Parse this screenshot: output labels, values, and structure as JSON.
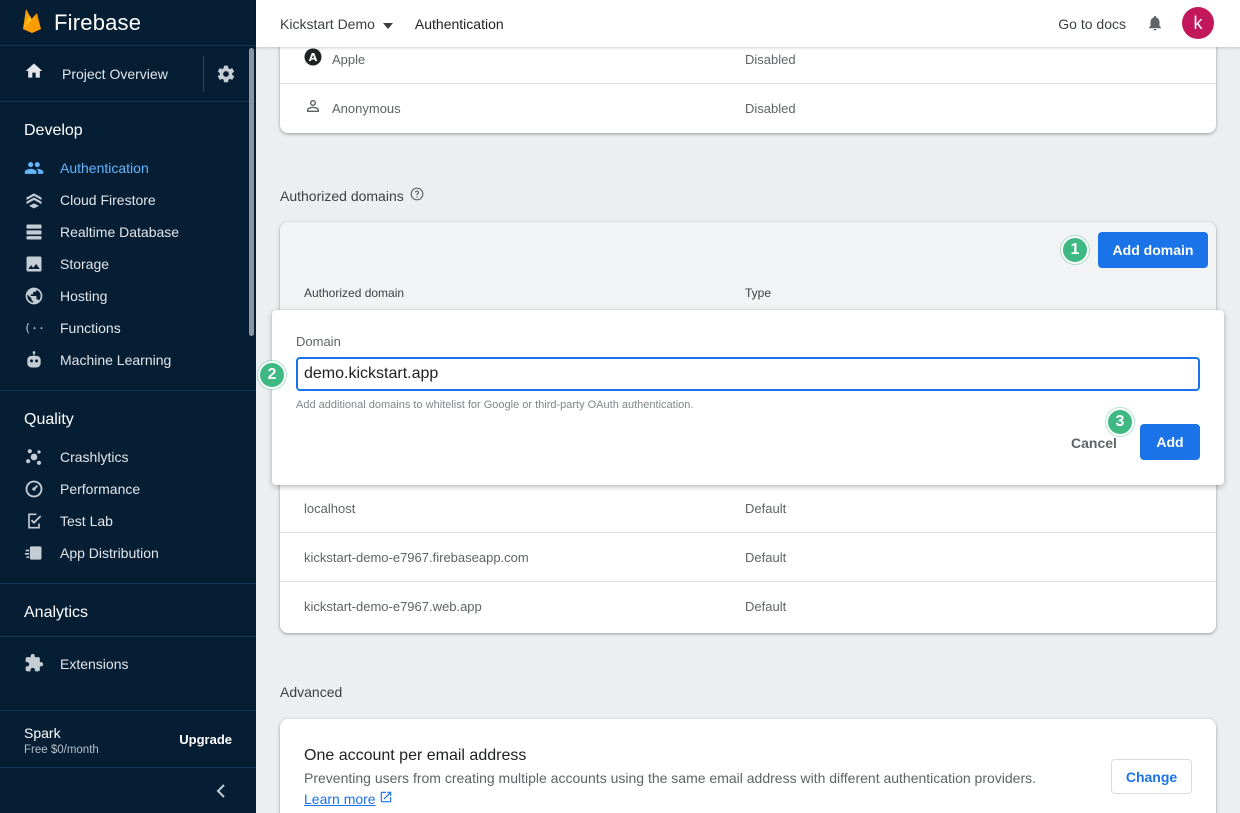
{
  "app": {
    "brand": "Firebase"
  },
  "topbar": {
    "project_name": "Kickstart Demo",
    "page_title": "Authentication",
    "docs_link": "Go to docs",
    "avatar_letter": "k"
  },
  "sidebar": {
    "overview_label": "Project Overview",
    "develop": {
      "title": "Develop",
      "items": [
        {
          "label": "Authentication",
          "icon": "people-icon",
          "active": true
        },
        {
          "label": "Cloud Firestore",
          "icon": "firestore-icon"
        },
        {
          "label": "Realtime Database",
          "icon": "database-icon"
        },
        {
          "label": "Storage",
          "icon": "photo-icon"
        },
        {
          "label": "Hosting",
          "icon": "globe-icon"
        },
        {
          "label": "Functions",
          "icon": "functions-icon"
        },
        {
          "label": "Machine Learning",
          "icon": "robot-icon"
        }
      ]
    },
    "quality": {
      "title": "Quality",
      "items": [
        {
          "label": "Crashlytics",
          "icon": "crashlytics-icon"
        },
        {
          "label": "Performance",
          "icon": "speedometer-icon"
        },
        {
          "label": "Test Lab",
          "icon": "checklist-icon"
        },
        {
          "label": "App Distribution",
          "icon": "distribution-icon"
        }
      ]
    },
    "analytics_title": "Analytics",
    "extensions_label": "Extensions",
    "plan": {
      "name": "Spark",
      "price": "Free $0/month",
      "upgrade": "Upgrade"
    }
  },
  "providers": [
    {
      "name": "Apple",
      "status": "Disabled",
      "icon": "apple-icon"
    },
    {
      "name": "Anonymous",
      "status": "Disabled",
      "icon": "person-icon"
    }
  ],
  "authorized_domains": {
    "title": "Authorized domains",
    "add_button": "Add domain",
    "col_domain": "Authorized domain",
    "col_type": "Type",
    "rows": [
      {
        "domain": "localhost",
        "type": "Default"
      },
      {
        "domain": "kickstart-demo-e7967.firebaseapp.com",
        "type": "Default"
      },
      {
        "domain": "kickstart-demo-e7967.web.app",
        "type": "Default"
      }
    ]
  },
  "dialog": {
    "label": "Domain",
    "value": "demo.kickstart.app",
    "hint": "Add additional domains to whitelist for Google or third-party OAuth authentication.",
    "cancel": "Cancel",
    "add": "Add"
  },
  "steps": [
    "1",
    "2",
    "3"
  ],
  "advanced": {
    "title": "Advanced",
    "setting_title": "One account per email address",
    "setting_desc": "Preventing users from creating multiple accounts using the same email address with different authentication providers.",
    "learn_more": "Learn more",
    "change_button": "Change"
  },
  "colors": {
    "sidebar_bg": "#051e34",
    "accent": "#1a73e8",
    "step_badge": "#3fb984",
    "active_nav": "#65b6ff",
    "avatar": "#c2185b"
  }
}
